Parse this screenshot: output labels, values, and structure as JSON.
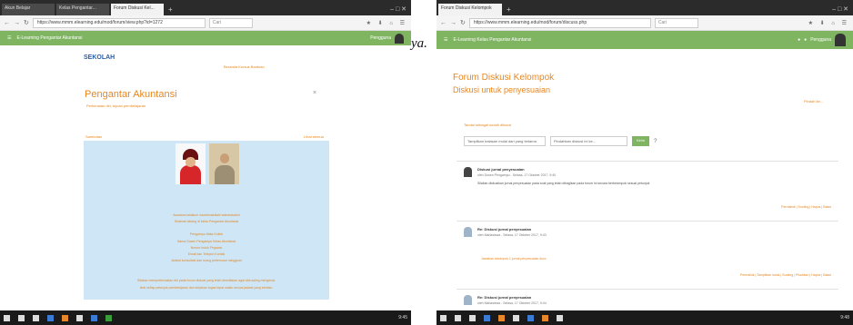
{
  "screen1": {
    "tabs": [
      "Akun Belajar",
      "Kelas Pengantar...",
      "Forum Diskusi Kel..."
    ],
    "url": "https://www.mmm.elearning.edu/mod/forum/view.php?id=1272",
    "search": "Cari",
    "greenbar": {
      "left": "E-Learning Pengantar Akuntansi",
      "user": "Pengguna"
    },
    "logo": "SEKOLAH",
    "toplinks": "Beranda   Kursus   Bantuan",
    "title": "Pengantar Akuntansi",
    "closex": "×",
    "subtitle": "Perkenalan diri, tujuan pembelajaran",
    "section": "Sambutan",
    "right": "Lihat semua",
    "post": [
      "Assalamu'alaikum warahmatullahi wabarakatuh",
      "Selamat datang di kelas Pengantar Akuntansi",
      "Pengampu Mata Kuliah",
      "Nama Dosen Pengampu Kelas Akuntansi",
      "Nomor Induk Pegawai",
      "Email dan Telepon Kontak",
      "Jadwal konsultasi dan ruang pertemuan mingguan",
      "Silakan memperkenalkan diri pada forum diskusi yang telah disediakan agar kita saling mengenal.",
      "Ikuti setiap petunjuk pembelajaran dan kerjakan tugas tepat waktu sesuai jadwal yang berlaku."
    ],
    "clock": "9:45"
  },
  "screen2": {
    "tabs": [
      "Forum Diskusi Kelompok"
    ],
    "url": "https://www.mmm.elearning.edu/mod/forum/discuss.php",
    "search": "Cari",
    "greenbar": {
      "left": "E-Learning  Kelas Pengantar Akuntansi",
      "user": "Pengguna"
    },
    "title": "Forum Diskusi Kelompok",
    "subtitle": "Diskusi untuk penyesuaian",
    "rlink": "Pindah ke...",
    "meta": "Tandai sebagai sudah dibaca",
    "filters": [
      "Tampilkan balasan mulai dari yang terlama",
      "Pindahkan diskusi ini ke..."
    ],
    "button": "Kirim",
    "qm": "?",
    "entries": [
      {
        "title": "Diskusi jurnal penyesuaian",
        "by": "oleh Dosen Pengampu - Selasa, 17 Oktober 2017, 9:40",
        "body": "Silakan diskusikan jurnal penyesuaian pada soal yang telah dibagikan pada forum ini secara berkelompok sesuai petunjuk",
        "links": "Permalink | Sunting | Hapus | Balas"
      },
      {
        "title": "Re: Diskusi jurnal penyesuaian",
        "by": "oleh Mahasiswa - Selasa, 17 Oktober 2017, 9:43",
        "attach": "Jawaban kelompok 1 jurnal penyesuaian.docx",
        "links": "Permalink | Tampilkan induk | Sunting | Pisahkan | Hapus | Balas"
      },
      {
        "title": "Re: Diskusi jurnal penyesuaian",
        "by": "oleh Mahasiswa - Selasa, 17 Oktober 2017, 9:44"
      }
    ],
    "clock": "9:48"
  },
  "overlay": "ya."
}
